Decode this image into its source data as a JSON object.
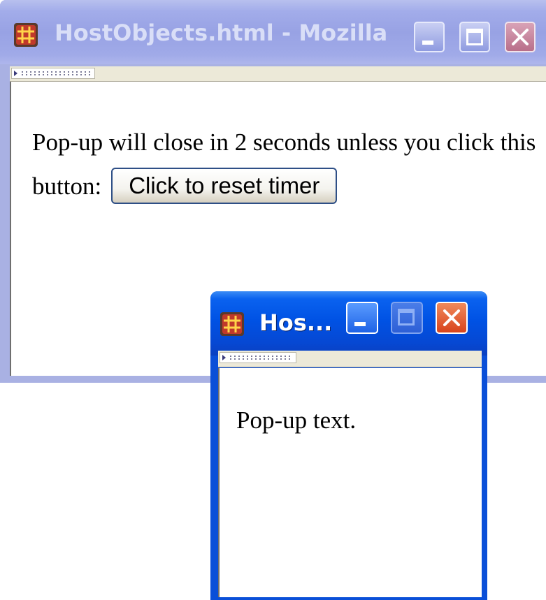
{
  "main_window": {
    "title": "HostObjects.html - Mozilla",
    "text": "Pop-up will close in 2 seconds unless you click this button:",
    "button_label": "Click to reset timer",
    "active": false
  },
  "popup_window": {
    "title": "Hos...",
    "text": "Pop-up text.",
    "active": true
  },
  "icons": {
    "app": "mozilla-grid-icon",
    "minimize": "minimize-icon",
    "maximize": "maximize-icon",
    "close": "close-icon",
    "toolbar_grip": "toolbar-grip-icon"
  },
  "colors": {
    "active_titlebar": "#0052e4",
    "inactive_titlebar": "#a2acea",
    "close_button": "#d8431c",
    "button_border": "#2e4f86"
  }
}
